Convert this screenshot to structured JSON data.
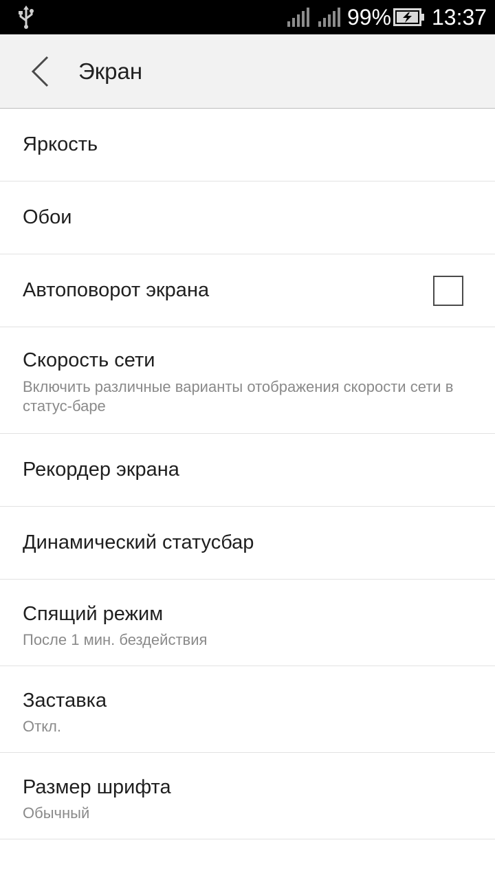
{
  "status_bar": {
    "battery_percent": "99%",
    "time": "13:37",
    "icons": [
      "usb-icon",
      "signal-icon",
      "signal-icon",
      "battery-charging-icon"
    ]
  },
  "app_bar": {
    "title": "Экран",
    "back_icon": "back-arrow-icon"
  },
  "settings": {
    "brightness": {
      "title": "Яркость"
    },
    "wallpaper": {
      "title": "Обои"
    },
    "auto_rotate": {
      "title": "Автоповорот экрана",
      "checked": false
    },
    "network_speed": {
      "title": "Скорость сети",
      "summary": "Включить различные варианты отображения скорости сети в статус-баре"
    },
    "screen_recorder": {
      "title": "Рекордер экрана"
    },
    "dynamic_statusbar": {
      "title": "Динамический статусбар"
    },
    "sleep": {
      "title": "Спящий режим",
      "summary": "После 1 мин. бездействия"
    },
    "daydream": {
      "title": "Заставка",
      "summary": "Откл."
    },
    "font_size": {
      "title": "Размер шрифта",
      "summary": "Обычный"
    }
  },
  "colors": {
    "status_bar": "#000000",
    "app_bar": "#f2f2f2",
    "title_text": "#1f1f1f",
    "summary_text": "#8a8a8a",
    "divider": "#e2e2e2"
  }
}
